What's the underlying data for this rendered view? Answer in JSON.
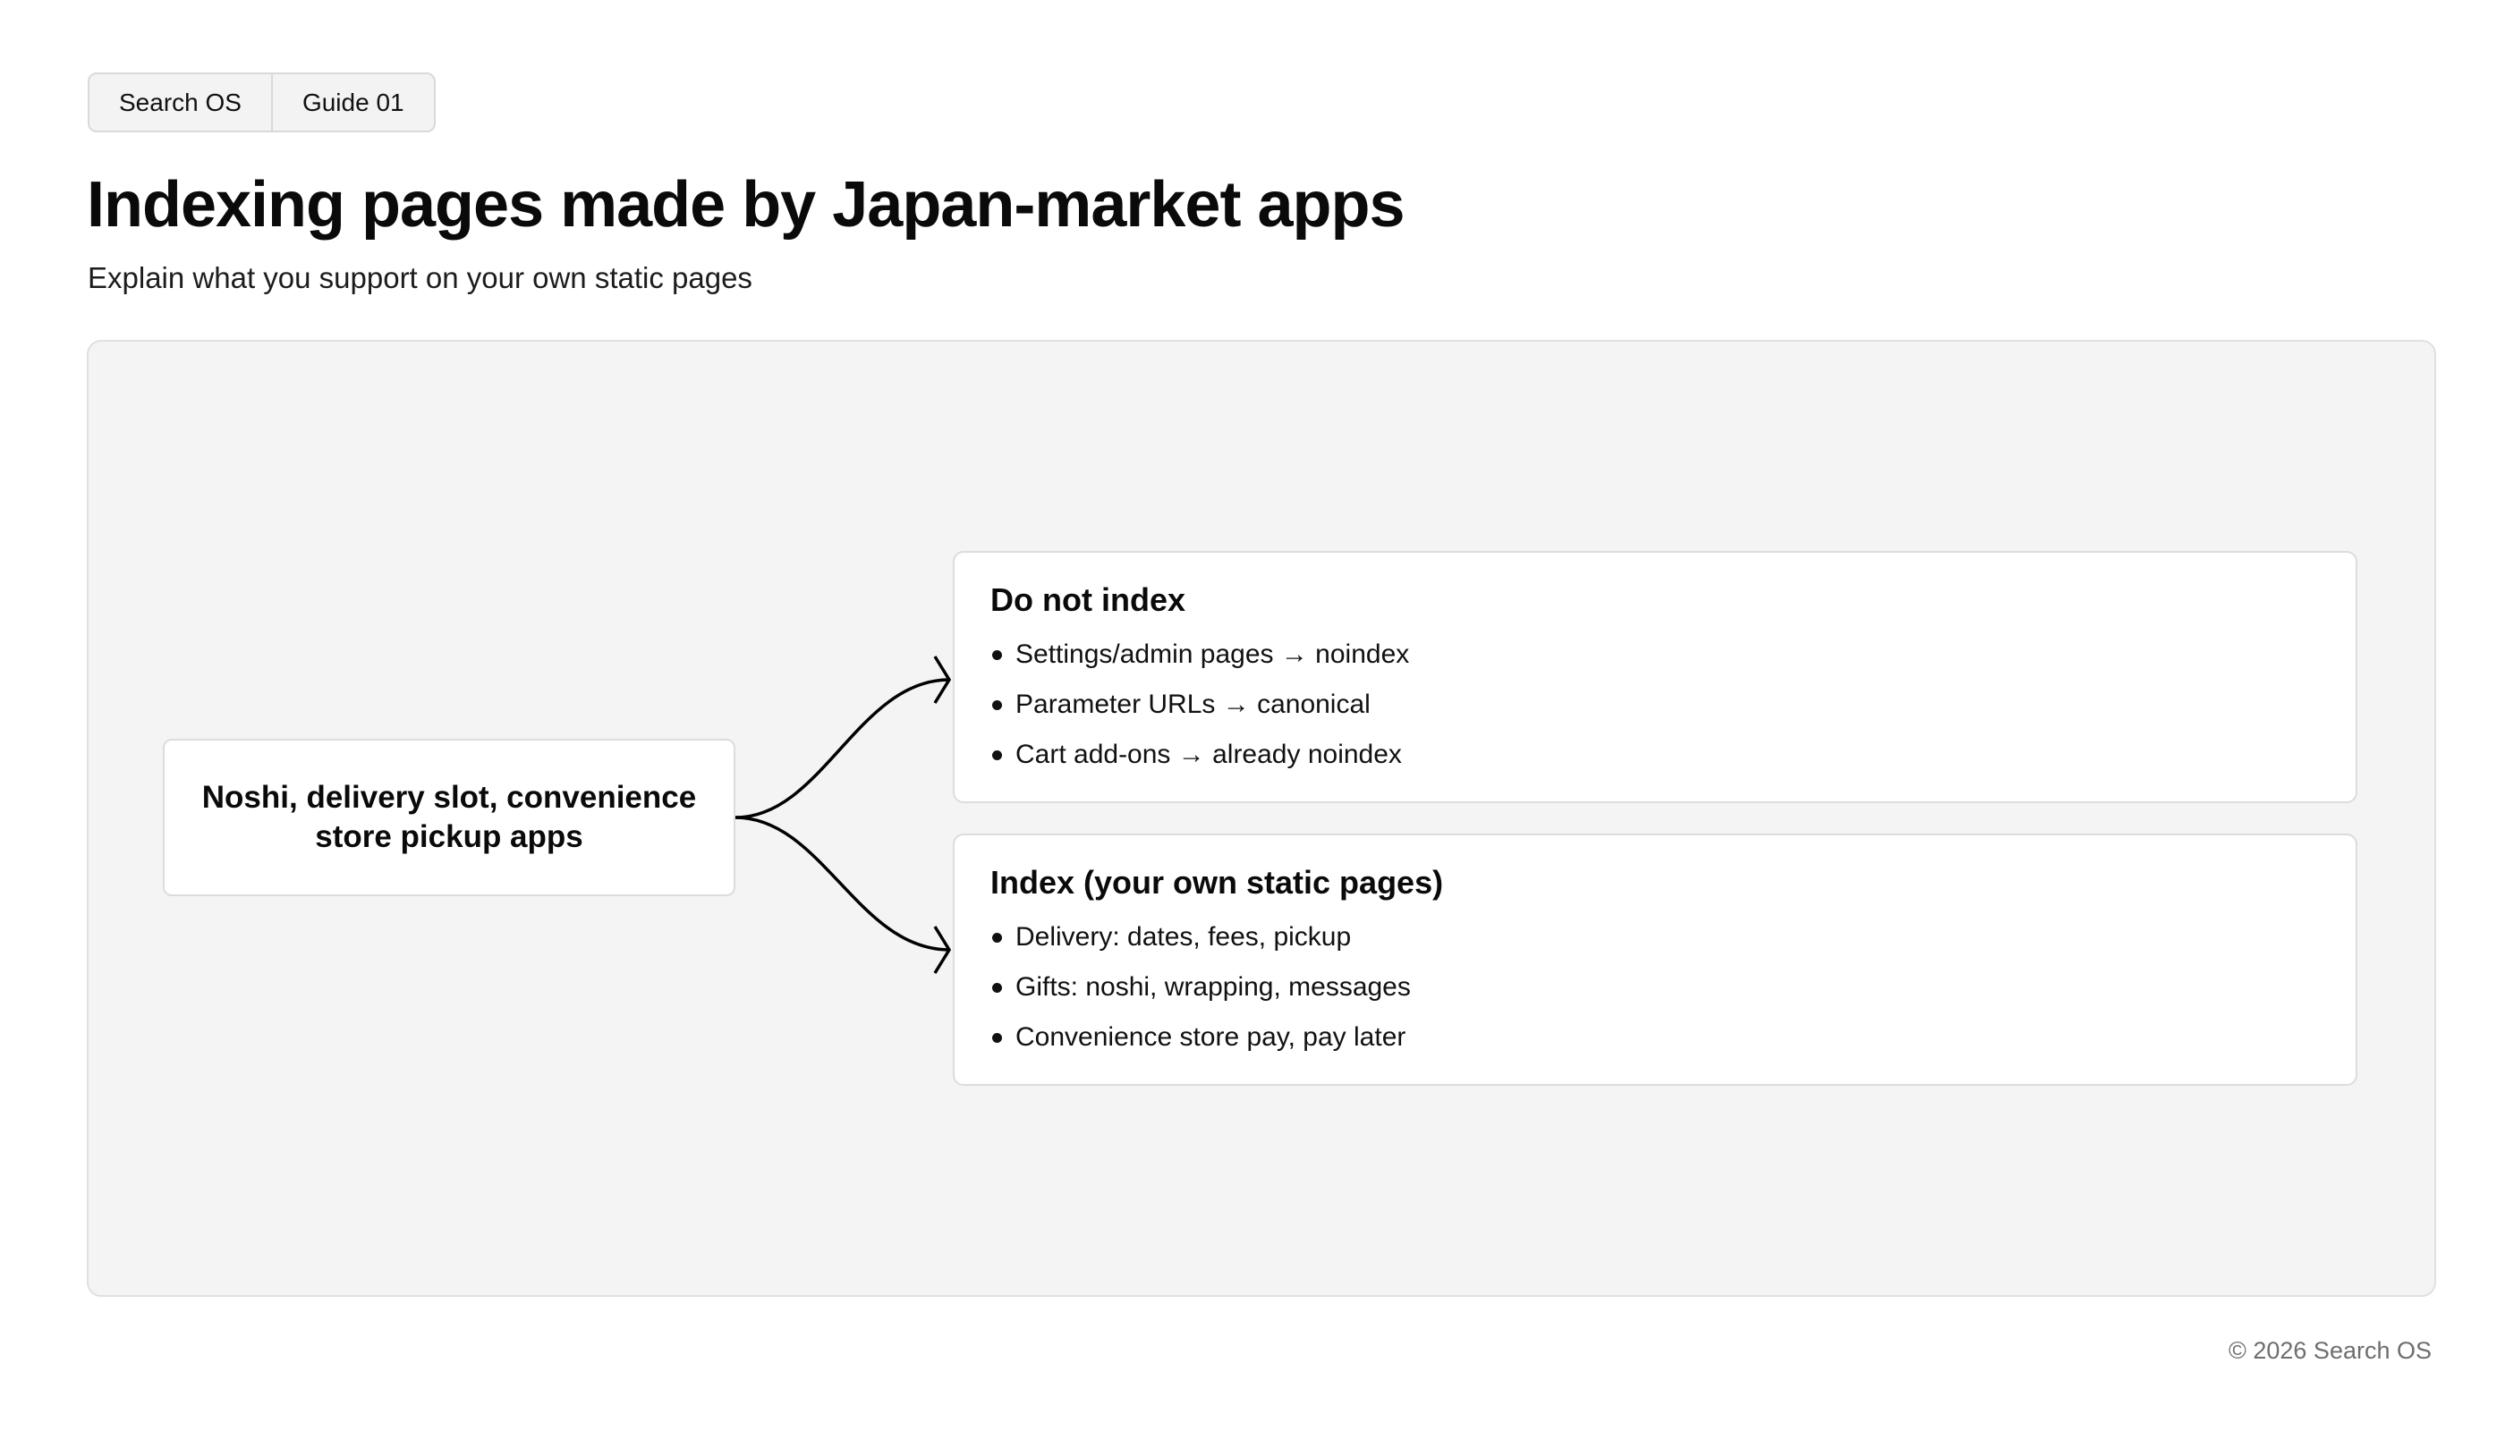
{
  "tabs": [
    {
      "label": "Search OS"
    },
    {
      "label": "Guide 01"
    }
  ],
  "page": {
    "title": "Indexing pages made by Japan-market apps",
    "subtitle": "Explain what you support on your own static pages"
  },
  "diagram": {
    "source": {
      "label": "Noshi, delivery slot, convenience store pickup apps"
    },
    "targets": [
      {
        "title": "Do not index",
        "items": [
          "Settings/admin pages → noindex",
          "Parameter URLs → canonical",
          "Cart add-ons → already noindex"
        ]
      },
      {
        "title": "Index (your own static pages)",
        "items": [
          "Delivery: dates, fees, pickup",
          "Gifts: noshi, wrapping, messages",
          "Convenience store pay, pay later"
        ]
      }
    ]
  },
  "footer": {
    "copyright": "© 2026 Search OS"
  }
}
